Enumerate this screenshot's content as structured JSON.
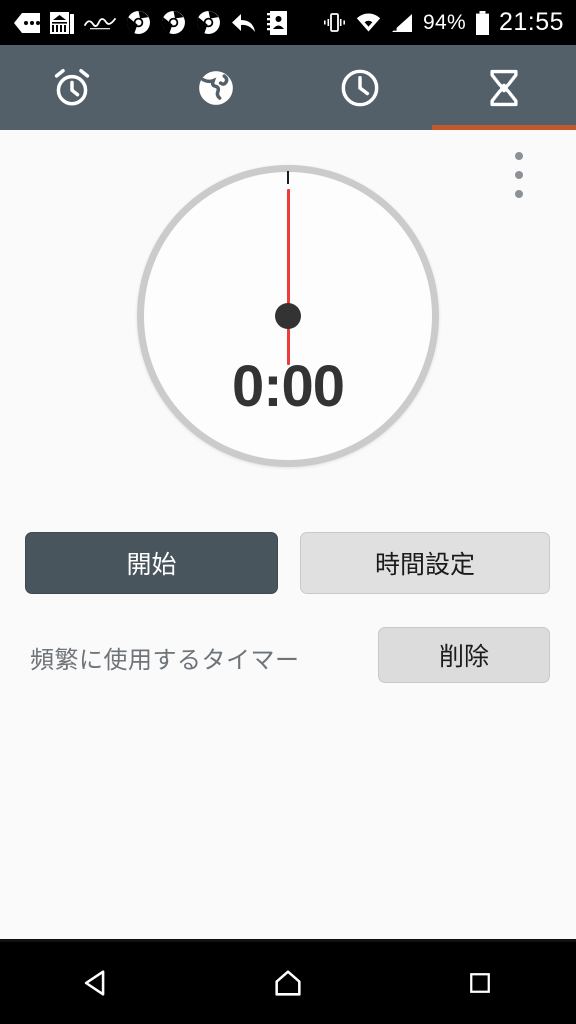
{
  "status_bar": {
    "notification_icons": [
      {
        "name": "sim-card-dots-icon"
      },
      {
        "name": "news-app-icon"
      },
      {
        "name": "jawbone-app-icon"
      },
      {
        "name": "chrome-icon-1"
      },
      {
        "name": "chrome-icon-2"
      },
      {
        "name": "chrome-icon-3"
      },
      {
        "name": "back-arrow-icon"
      },
      {
        "name": "contacts-book-icon"
      }
    ],
    "vibrate_icon": "vibrate-icon",
    "wifi_icon": "wifi-icon",
    "signal_icon": "cellular-signal-icon",
    "battery_percent": "94%",
    "battery_icon": "battery-icon",
    "clock": "21:55"
  },
  "tabs": [
    {
      "id": "alarm",
      "icon": "alarm-clock-icon",
      "active": false
    },
    {
      "id": "worldclock",
      "icon": "globe-icon",
      "active": false
    },
    {
      "id": "stopwatch",
      "icon": "clock-icon",
      "active": false
    },
    {
      "id": "timer",
      "icon": "hourglass-icon",
      "active": true
    }
  ],
  "colors": {
    "tabbar_background": "#546069",
    "active_tab_indicator": "#C05A2E",
    "start_button": "#49555D",
    "timer_hand": "#EE3B3B",
    "dial_ring": "#CBCBCB",
    "page_background": "#FAFAFA",
    "hub": "#333333"
  },
  "overflow_menu": {
    "name": "overflow-menu-icon",
    "dots": 3
  },
  "timer": {
    "display": "0:00",
    "hand_angle_degrees": 0,
    "tick_mark": "top-tick"
  },
  "buttons": {
    "start": "開始",
    "set_time": "時間設定",
    "delete": "削除"
  },
  "labels": {
    "frequently_used_timer": "頻繁に使用するタイマー"
  },
  "navigation_bar": {
    "back": "back-triangle-icon",
    "home": "home-icon",
    "recents": "recents-square-icon"
  }
}
